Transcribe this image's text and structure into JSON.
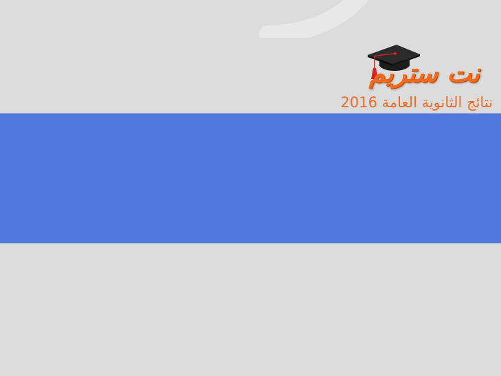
{
  "header": {
    "logo": {
      "title": "نت ستريم",
      "subtitle": "نتائج الثانوية العامة 2016",
      "icon": "graduation-cap-icon"
    }
  },
  "colors": {
    "page_background": "#dcdcdc",
    "banner": "#5178de",
    "logo_orange": "#f26a1a",
    "subtitle_orange": "#ee6b25"
  }
}
